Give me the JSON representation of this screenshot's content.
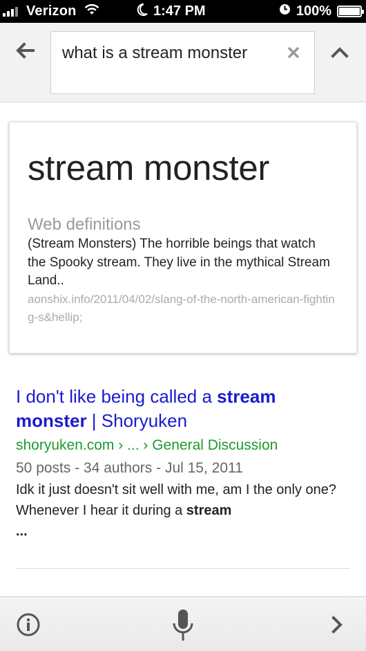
{
  "status_bar": {
    "carrier": "Verizon",
    "time": "1:47 PM",
    "battery": "100%",
    "battery_level": 1.0,
    "icons": [
      "signal-icon",
      "wifi-icon",
      "moon-icon",
      "clock-icon",
      "battery-icon"
    ]
  },
  "search": {
    "query": "what is a stream monster",
    "icons": [
      "back-arrow-icon",
      "clear-icon",
      "chevron-up-icon"
    ]
  },
  "definition": {
    "term": "stream monster",
    "section_label": "Web definitions",
    "text": "(Stream Monsters) The horrible beings that watch the Spooky stream. They live in the mythical Stream Land..",
    "source": "aonshix.info/2011/04/02/slang-of-the-north-american-fighting-s&hellip;"
  },
  "result": {
    "title_pre": "I don't like being called a ",
    "title_bold": "stream monster",
    "title_post": " | Shoryuken",
    "url": "shoryuken.com › ... › General Discussion",
    "meta": "50 posts - 34 authors - Jul 15, 2011",
    "snippet_pre": "Idk it just doesn't sit well with me, am I the only one? Whenever I hear it during a ",
    "snippet_bold": "stream",
    "snippet_end": "..."
  },
  "bottom_bar": {
    "icons": [
      "info-icon",
      "microphone-icon",
      "chevron-right-icon"
    ]
  },
  "colors": {
    "link": "#1a1ad0",
    "url": "#1e9a2e",
    "muted": "#999999"
  }
}
